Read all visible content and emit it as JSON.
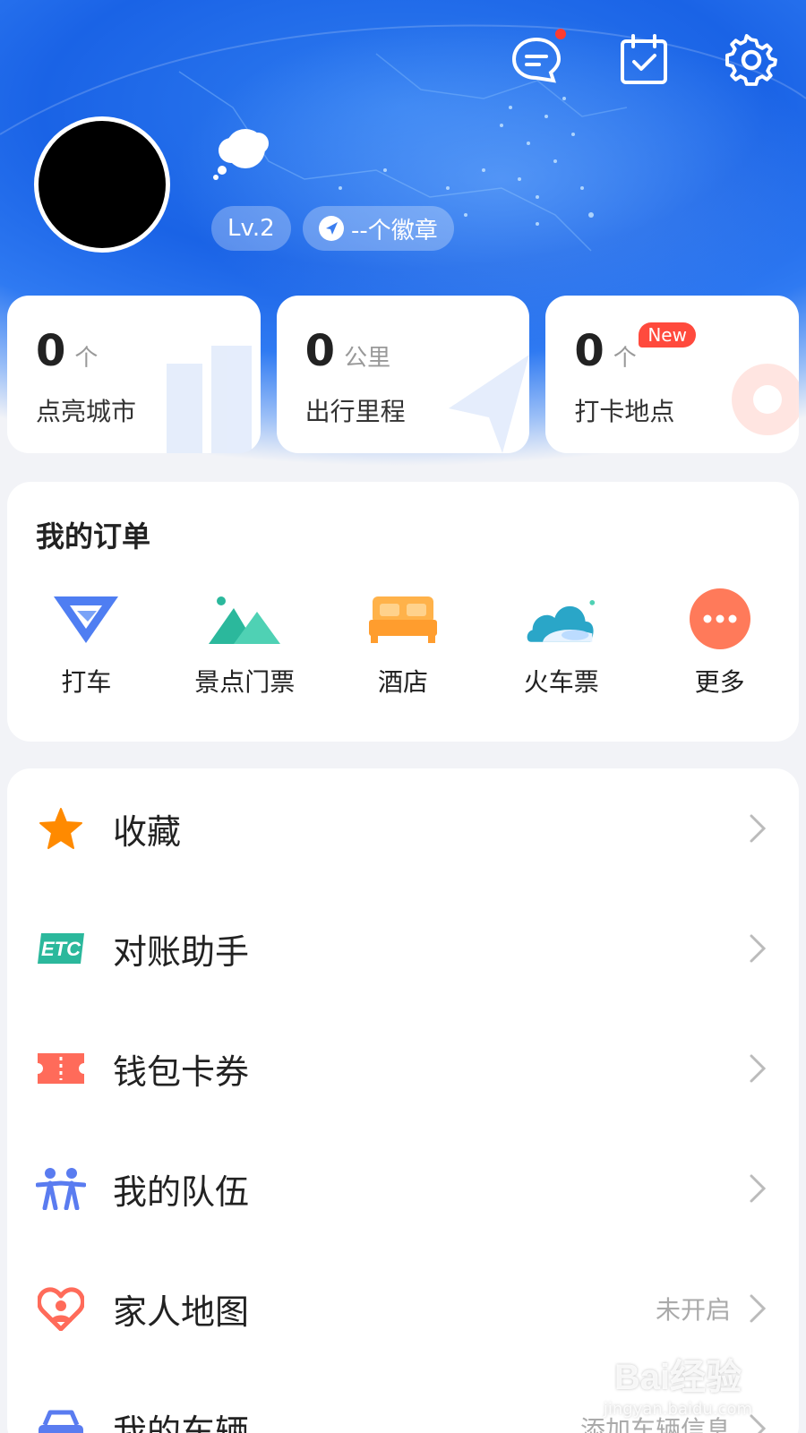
{
  "header": {
    "icons": [
      "message-icon",
      "checkin-calendar-icon",
      "settings-icon"
    ],
    "level": "Lv.2",
    "badge_text": "--个徽章"
  },
  "stats": [
    {
      "value": "0",
      "unit": "个",
      "label": "点亮城市"
    },
    {
      "value": "0",
      "unit": "公里",
      "label": "出行里程"
    },
    {
      "value": "0",
      "unit": "个",
      "label": "打卡地点",
      "badge": "New"
    }
  ],
  "orders": {
    "title": "我的订单",
    "items": [
      {
        "label": "打车",
        "icon": "taxi-icon"
      },
      {
        "label": "景点门票",
        "icon": "mountain-icon"
      },
      {
        "label": "酒店",
        "icon": "bed-icon"
      },
      {
        "label": "火车票",
        "icon": "train-cloud-icon"
      },
      {
        "label": "更多",
        "icon": "more-dots-icon"
      }
    ]
  },
  "menu": [
    {
      "label": "收藏",
      "value": "",
      "icon": "star-icon"
    },
    {
      "label": "对账助手",
      "value": "",
      "icon": "etc-icon"
    },
    {
      "label": "钱包卡券",
      "value": "",
      "icon": "ticket-icon"
    },
    {
      "label": "我的队伍",
      "value": "",
      "icon": "team-icon"
    },
    {
      "label": "家人地图",
      "value": "未开启",
      "icon": "family-heart-icon"
    },
    {
      "label": "我的车辆",
      "value": "添加车辆信息",
      "icon": "car-icon"
    }
  ],
  "watermark": {
    "line1": "Bai经验",
    "line2": "jingyan.baidu.com"
  },
  "colors": {
    "primary": "#1a63e6",
    "badge_red": "#ff4a3d",
    "accent_orange": "#ff8a00"
  }
}
